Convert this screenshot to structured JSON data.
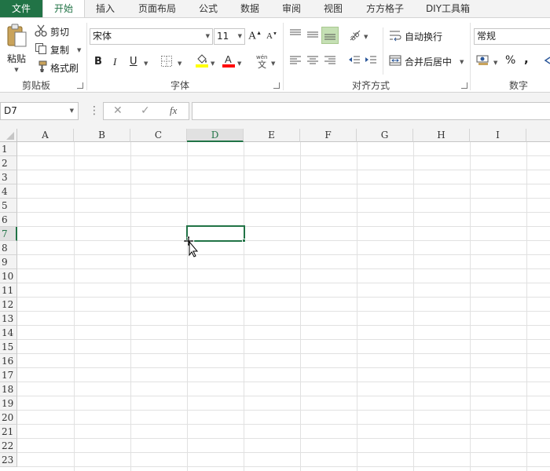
{
  "tabs": [
    {
      "label": "文件"
    },
    {
      "label": "开始"
    },
    {
      "label": "插入"
    },
    {
      "label": "页面布局"
    },
    {
      "label": "公式"
    },
    {
      "label": "数据"
    },
    {
      "label": "审阅"
    },
    {
      "label": "视图"
    },
    {
      "label": "方方格子"
    },
    {
      "label": "DIY工具箱"
    }
  ],
  "clipboard": {
    "paste": "粘贴",
    "cut": "剪切",
    "copy": "复制",
    "format_painter": "格式刷",
    "group": "剪贴板"
  },
  "font": {
    "name": "宋体",
    "size": "11",
    "bold": "B",
    "italic": "I",
    "underline": "U",
    "group": "字体"
  },
  "alignment": {
    "wrap_text": "自动换行",
    "merge_center": "合并后居中",
    "group": "对齐方式"
  },
  "number": {
    "format": "常规",
    "percent": "%",
    "comma": ",",
    "group": "数字"
  },
  "formula_bar": {
    "name_box": "D7",
    "cancel": "✕",
    "enter": "✓",
    "fx": "fx",
    "value": ""
  },
  "grid": {
    "columns": [
      "A",
      "B",
      "C",
      "D",
      "E",
      "F",
      "G",
      "H",
      "I"
    ],
    "rows": [
      "1",
      "2",
      "3",
      "4",
      "5",
      "6",
      "7",
      "8",
      "9",
      "10",
      "11",
      "12",
      "13",
      "14",
      "15",
      "16",
      "17",
      "18",
      "19",
      "20",
      "21",
      "22",
      "23"
    ],
    "selected_cell": "D7",
    "selected_column": "D",
    "selected_row": "7"
  },
  "colors": {
    "accent": "#217346",
    "fill_color": "#ffff00",
    "font_color": "#ff0000"
  }
}
